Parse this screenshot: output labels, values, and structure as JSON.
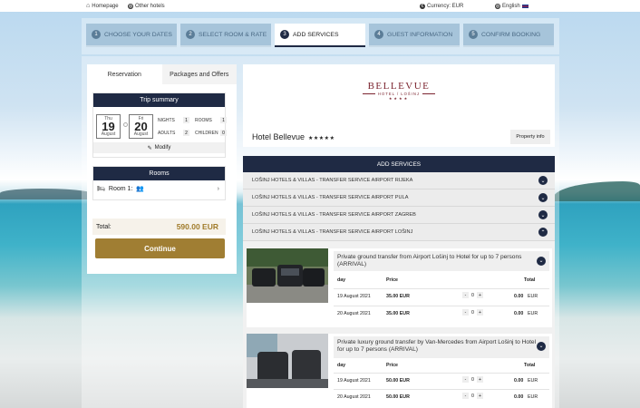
{
  "topbar": {
    "home": "Homepage",
    "other": "Other hotels",
    "currency": "Currency: EUR",
    "language": "English"
  },
  "steps": [
    {
      "num": "1",
      "label": "CHOOSE YOUR DATES"
    },
    {
      "num": "2",
      "label": "SELECT ROOM & RATE"
    },
    {
      "num": "3",
      "label": "ADD SERVICES"
    },
    {
      "num": "4",
      "label": "GUEST INFORMATION"
    },
    {
      "num": "5",
      "label": "CONFIRM BOOKING"
    }
  ],
  "left": {
    "tab_reservation": "Reservation",
    "tab_packages": "Packages and Offers",
    "trip_title": "Trip summary",
    "checkin": {
      "weekday": "Thu",
      "day": "19",
      "month": "August"
    },
    "checkout": {
      "weekday": "Fri",
      "day": "20",
      "month": "August"
    },
    "nights_label": "NIGHTS",
    "nights": "1",
    "rooms_label": "ROOMS",
    "rooms": "1",
    "adults_label": "ADULTS",
    "adults": "2",
    "children_label": "CHILDREN",
    "children": "0",
    "modify": "Modify",
    "rooms_title": "Rooms",
    "room1": "Room 1:",
    "total_label": "Total:",
    "total_amount": "590.00 EUR",
    "continue": "Continue"
  },
  "hotel": {
    "logo_name": "BELLEVUE",
    "logo_sub": "HOTEL / LOŠINJ",
    "logo_stars": "★★★★",
    "name": "Hotel Bellevue",
    "stars": "★★★★★",
    "property_info": "Property info"
  },
  "services": {
    "header": "ADD SERVICES",
    "groups": [
      "LOŠINJ HOTELS & VILLAS - TRANSFER SERVICE AIRPORT RIJEKA",
      "LOŠINJ HOTELS & VILLAS - TRANSFER SERVICE AIRPORT PULA",
      "LOŠINJ HOTELS & VILLAS - TRANSFER SERVICE AIRPORT ZAGREB",
      "LOŠINJ HOTELS & VILLAS - TRANSFER SERVICE AIRPORT LOŠINJ"
    ],
    "col_day": "day",
    "col_price": "Price",
    "col_total": "Total",
    "cards": [
      {
        "title": "Private ground transfer from Airport Lošinj to Hotel for up to 7 persons (ARRIVAL)",
        "rows": [
          {
            "day": "19 August 2021",
            "price": "35.00 EUR",
            "qty": "0",
            "total": "0.00",
            "cur": "EUR"
          },
          {
            "day": "20 August 2021",
            "price": "35.00 EUR",
            "qty": "0",
            "total": "0.00",
            "cur": "EUR"
          }
        ]
      },
      {
        "title": "Private luxury ground transfer by Van-Mercedes from Airport Lošinj to Hotel for up to 7 persons (ARRIVAL)",
        "rows": [
          {
            "day": "19 August 2021",
            "price": "50.00 EUR",
            "qty": "0",
            "total": "0.00",
            "cur": "EUR"
          },
          {
            "day": "20 August 2021",
            "price": "50.00 EUR",
            "qty": "0",
            "total": "0.00",
            "cur": "EUR"
          }
        ]
      }
    ]
  },
  "colors": {
    "navy": "#1f2a44",
    "gold": "#a07e33",
    "burgundy": "#7c2530"
  }
}
